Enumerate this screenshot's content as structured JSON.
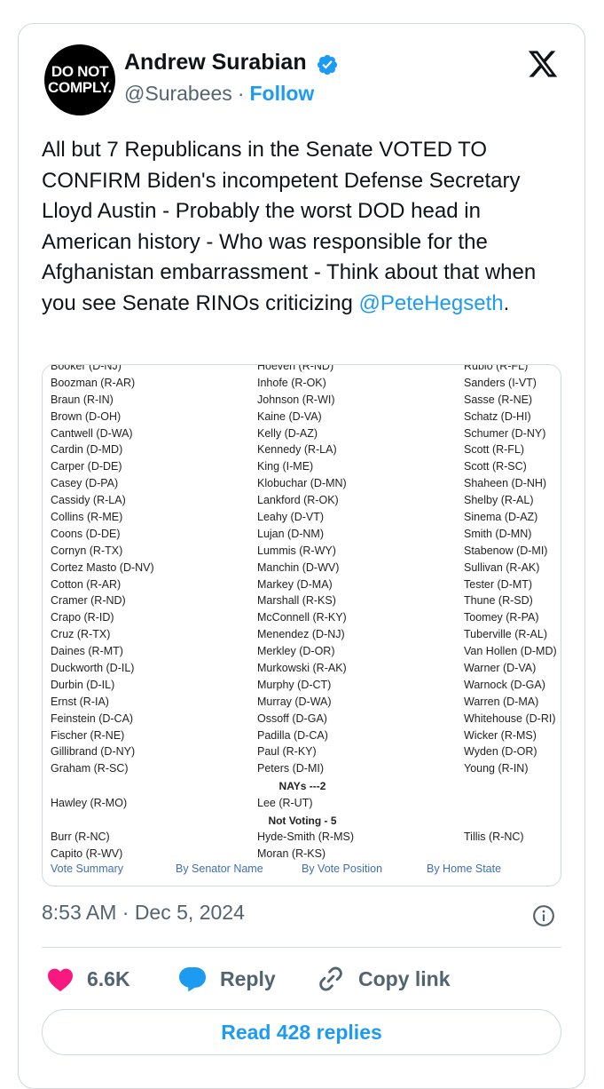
{
  "author": {
    "avatar_line1": "DO NOT",
    "avatar_line2": "COMPLY.",
    "name": "Andrew Surabian",
    "handle": "@Surabees",
    "separator": "·",
    "follow_label": "Follow",
    "verified_color": "#1d9bf0"
  },
  "tweet": {
    "text": "All but 7 Republicans in the Senate VOTED TO CONFIRM Biden's incompetent Defense Secretary Lloyd Austin - Probably the worst DOD head in American history - Who was responsible for the Afghanistan embarrassment - Think about that when you see Senate RINOs criticizing",
    "mention": "@PeteHegseth",
    "end_punct": ".",
    "timestamp": "8:53 AM · Dec 5, 2024"
  },
  "vote_image": {
    "col1": [
      "Booker (D-NJ)",
      "Boozman (R-AR)",
      "Braun (R-IN)",
      "Brown (D-OH)",
      "Cantwell (D-WA)",
      "Cardin (D-MD)",
      "Carper (D-DE)",
      "Casey (D-PA)",
      "Cassidy (R-LA)",
      "Collins (R-ME)",
      "Coons (D-DE)",
      "Cornyn (R-TX)",
      "Cortez Masto (D-NV)",
      "Cotton (R-AR)",
      "Cramer (R-ND)",
      "Crapo (R-ID)",
      "Cruz (R-TX)",
      "Daines (R-MT)",
      "Duckworth (D-IL)",
      "Durbin (D-IL)",
      "Ernst (R-IA)",
      "Feinstein (D-CA)",
      "Fischer (R-NE)",
      "Gillibrand (D-NY)",
      "Graham (R-SC)"
    ],
    "col2": [
      "Hoeven (R-ND)",
      "Inhofe (R-OK)",
      "Johnson (R-WI)",
      "Kaine (D-VA)",
      "Kelly (D-AZ)",
      "Kennedy (R-LA)",
      "King (I-ME)",
      "Klobuchar (D-MN)",
      "Lankford (R-OK)",
      "Leahy (D-VT)",
      "Lujan (D-NM)",
      "Lummis (R-WY)",
      "Manchin (D-WV)",
      "Markey (D-MA)",
      "Marshall (R-KS)",
      "McConnell (R-KY)",
      "Menendez (D-NJ)",
      "Merkley (D-OR)",
      "Murkowski (R-AK)",
      "Murphy (D-CT)",
      "Murray (D-WA)",
      "Ossoff (D-GA)",
      "Padilla (D-CA)",
      "Paul (R-KY)",
      "Peters (D-MI)"
    ],
    "col3": [
      "Rubio (R-FL)",
      "Sanders (I-VT)",
      "Sasse (R-NE)",
      "Schatz (D-HI)",
      "Schumer (D-NY)",
      "Scott (R-FL)",
      "Scott (R-SC)",
      "Shaheen (D-NH)",
      "Shelby (R-AL)",
      "Sinema (D-AZ)",
      "Smith (D-MN)",
      "Stabenow (D-MI)",
      "Sullivan (R-AK)",
      "Tester (D-MT)",
      "Thune (R-SD)",
      "Toomey (R-PA)",
      "Tuberville (R-AL)",
      "Van Hollen (D-MD)",
      "Warner (D-VA)",
      "Warnock (D-GA)",
      "Warren (D-MA)",
      "Whitehouse (D-RI)",
      "Wicker (R-MS)",
      "Wyden (D-OR)",
      "Young (R-IN)"
    ],
    "nays_heading": "NAYs ---2",
    "nays": [
      "Hawley (R-MO)",
      "Lee (R-UT)"
    ],
    "not_voting_heading": "Not Voting - 5",
    "not_voting": [
      "Burr (R-NC)",
      "Hyde-Smith (R-MS)",
      "Tillis (R-NC)",
      "Capito (R-WV)",
      "Moran (R-KS)"
    ],
    "tabs": [
      "Vote Summary",
      "By Senator Name",
      "By Vote Position",
      "By Home State"
    ]
  },
  "actions": {
    "likes": "6.6K",
    "reply_label": "Reply",
    "copy_label": "Copy link",
    "read_replies": "Read 428 replies",
    "heart_color": "#f91880",
    "reply_color": "#1d9bf0"
  }
}
